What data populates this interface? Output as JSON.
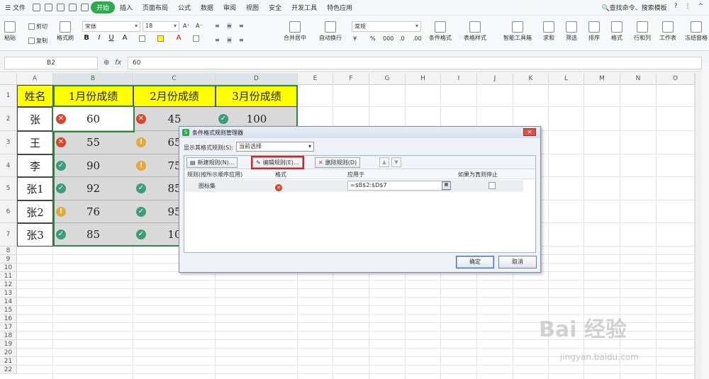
{
  "menubar": {
    "file": "文件",
    "tabs": [
      "开始",
      "插入",
      "页面布局",
      "公式",
      "数据",
      "审阅",
      "视图",
      "安全",
      "开发工具",
      "特色应用"
    ],
    "active_tab": "开始",
    "search": "查找命令、搜索模板"
  },
  "ribbon": {
    "paste": "粘贴",
    "cut": "剪切",
    "copy": "复制",
    "format_painter": "格式刷",
    "font_name": "宋体",
    "font_size": "18",
    "merge_center": "合并居中",
    "wrap_text": "自动换行",
    "number_format": "常规",
    "conditional_format": "条件格式",
    "table_style": "表格样式",
    "smart_toolbox": "智能工具箱",
    "sum": "求和",
    "filter": "筛选",
    "sort": "排序",
    "format": "格式",
    "row_col": "行和列",
    "worksheet": "工作表",
    "freeze": "冻结窗格"
  },
  "formula_bar": {
    "name_box": "B2",
    "fx": "fx",
    "value": "60"
  },
  "sheet": {
    "columns": [
      "A",
      "B",
      "C",
      "D",
      "E",
      "F",
      "G",
      "H",
      "I",
      "J",
      "K",
      "L",
      "M",
      "N",
      "O"
    ],
    "rows": [
      "1",
      "2",
      "3",
      "4",
      "5",
      "6",
      "7",
      "8",
      "9",
      "10",
      "11",
      "12",
      "13",
      "14",
      "15",
      "16",
      "17",
      "18",
      "19",
      "20",
      "21",
      "22"
    ],
    "header": [
      "姓名",
      "1月份成绩",
      "2月份成绩",
      "3月份成绩"
    ],
    "data": [
      {
        "name": "张",
        "b": "60",
        "bi": "cross",
        "c": "45",
        "ci": "cross",
        "d": "100",
        "di": "check"
      },
      {
        "name": "王",
        "b": "55",
        "bi": "cross",
        "c": "65",
        "ci": "warn",
        "d": "",
        "di": ""
      },
      {
        "name": "李",
        "b": "90",
        "bi": "check",
        "c": "75",
        "ci": "warn",
        "d": "",
        "di": ""
      },
      {
        "name": "张1",
        "b": "92",
        "bi": "check",
        "c": "85",
        "ci": "check",
        "d": "",
        "di": ""
      },
      {
        "name": "张2",
        "b": "76",
        "bi": "warn",
        "c": "95",
        "ci": "check",
        "d": "",
        "di": ""
      },
      {
        "name": "张3",
        "b": "85",
        "bi": "check",
        "c": "10",
        "ci": "check",
        "d": "",
        "di": ""
      }
    ]
  },
  "dialog": {
    "title": "条件格式规则管理器",
    "show_rules_label": "显示其格式规则(S):",
    "show_rules_value": "当前选择",
    "new_rule": "新建规则(N)...",
    "edit_rule": "编辑规则(E)...",
    "delete_rule": "删除规则(D)",
    "col_rule": "规则(按所示顺序应用)",
    "col_format": "格式",
    "col_apply": "应用于",
    "col_stop": "如果为真则停止",
    "rule_name": "图标集",
    "apply_to": "=$B$2:$D$7",
    "ok": "确定",
    "cancel": "取消"
  },
  "watermark": {
    "main": "Bai 经验",
    "sub": "jingyan.baidu.com"
  }
}
